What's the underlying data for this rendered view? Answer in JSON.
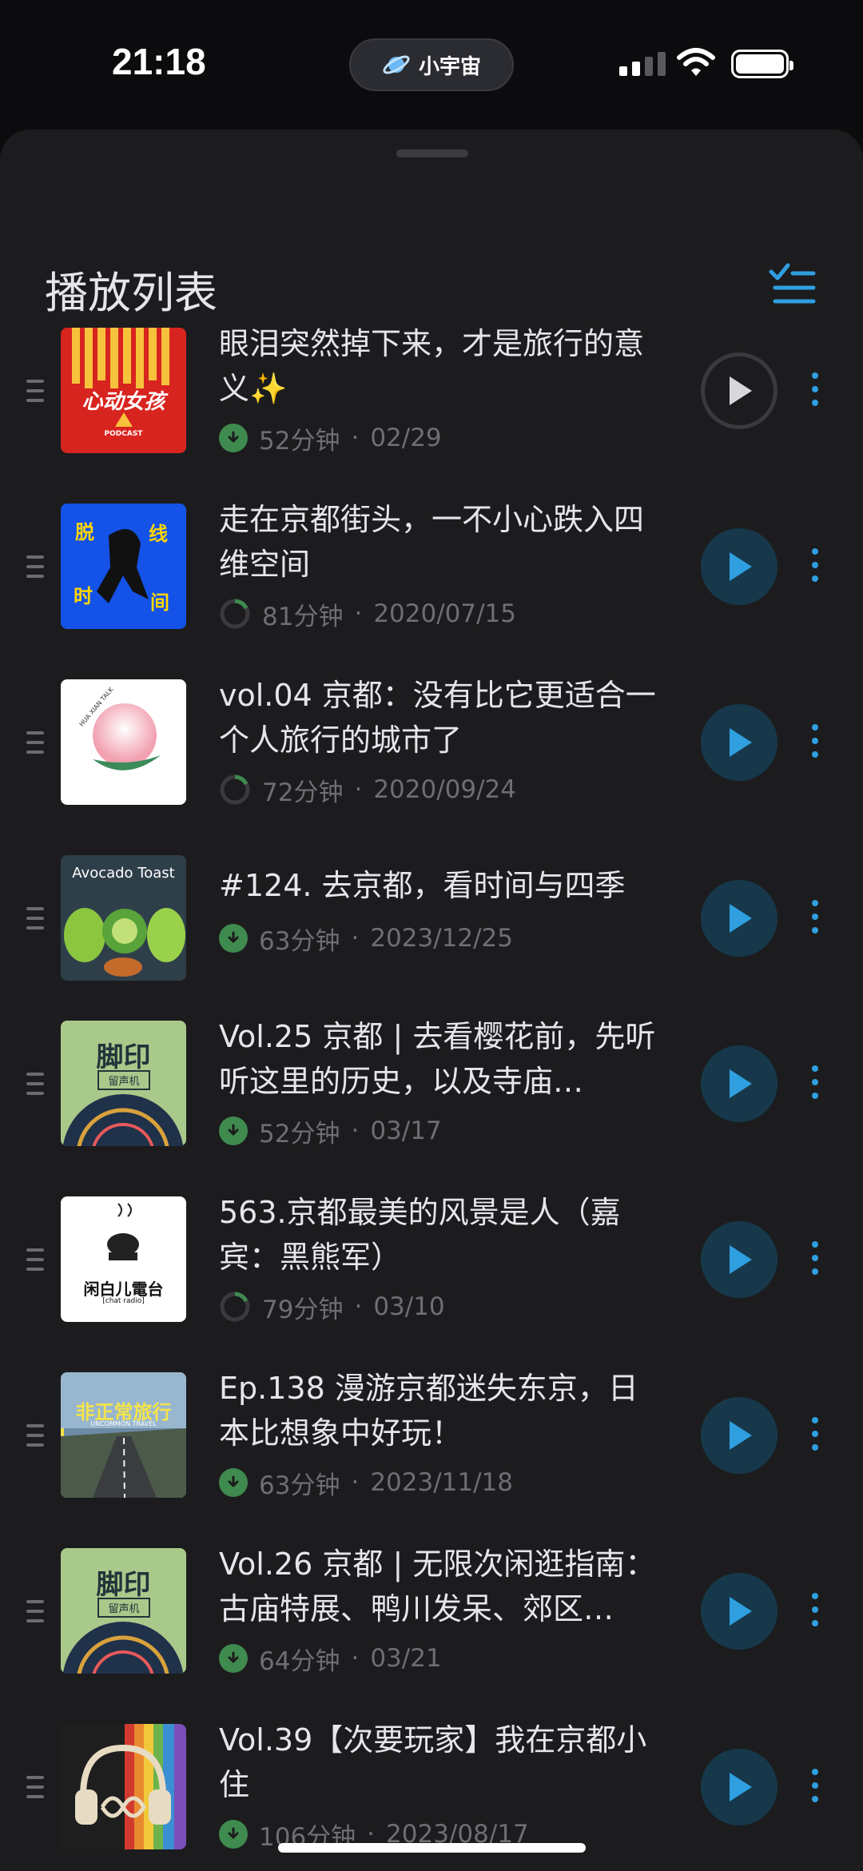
{
  "status": {
    "time": "21:18",
    "island_label": "小宇宙"
  },
  "header": {
    "title": "播放列表"
  },
  "colors": {
    "accent": "#2f9fe0",
    "download_green": "#3f8a4e",
    "sheet_bg": "#1c1c1e"
  },
  "items": [
    {
      "title": "眼泪突然掉下来，才是旅行的意义✨",
      "duration": "52分钟",
      "date": "02/29",
      "status": "downloaded",
      "current": true,
      "cover": "fries"
    },
    {
      "title": "走在京都街头，一不小心跌入四维空间",
      "duration": "81分钟",
      "date": "2020/07/15",
      "status": "progress",
      "current": false,
      "cover": "blue"
    },
    {
      "title": "vol.04 京都：没有比它更适合一个人旅行的城市了",
      "duration": "72分钟",
      "date": "2020/09/24",
      "status": "progress",
      "current": false,
      "cover": "peach"
    },
    {
      "title": "#124. 去京都，看时间与四季",
      "duration": "63分钟",
      "date": "2023/12/25",
      "status": "downloaded",
      "current": false,
      "cover": "avocado"
    },
    {
      "title": "Vol.25 京都 | 去看樱花前，先听听这里的历史，以及寺庙…",
      "duration": "52分钟",
      "date": "03/17",
      "status": "downloaded",
      "current": false,
      "cover": "jiaoyin"
    },
    {
      "title": "563.京都最美的风景是人（嘉宾：黑熊军）",
      "duration": "79分钟",
      "date": "03/10",
      "status": "progress",
      "current": false,
      "cover": "radio"
    },
    {
      "title": "Ep.138 漫游京都迷失东京，日本比想象中好玩！",
      "duration": "63分钟",
      "date": "2023/11/18",
      "status": "downloaded",
      "current": false,
      "cover": "road"
    },
    {
      "title": "Vol.26 京都 | 无限次闲逛指南：古庙特展、鸭川发呆、郊区…",
      "duration": "64分钟",
      "date": "03/21",
      "status": "downloaded",
      "current": false,
      "cover": "jiaoyin"
    },
    {
      "title": "Vol.39【次要玩家】我在京都小住",
      "duration": "106分钟",
      "date": "2023/08/17",
      "status": "downloaded",
      "current": false,
      "cover": "headphones"
    }
  ],
  "cover_texts": {
    "fries": "心动女孩",
    "fries_sub": "PODCAST",
    "avocado": "Avocado Toast",
    "jiaoyin": "脚印",
    "jiaoyin_sub": "留声机",
    "peach": "HUA XIAN TALK",
    "blue_a": "脱",
    "blue_b": "线",
    "blue_c": "时",
    "blue_d": "间",
    "radio": "闲白儿電台",
    "radio_sub": "[chat radio]",
    "road": "非正常旅行",
    "road_sub": "UNCOMMON TRAVEL"
  }
}
